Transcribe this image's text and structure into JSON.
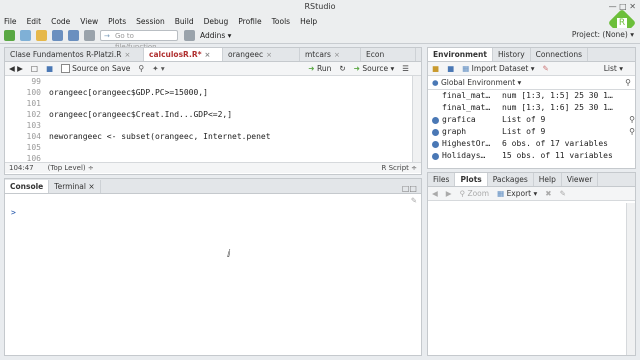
{
  "window": {
    "title": "RStudio"
  },
  "menu": [
    "File",
    "Edit",
    "Code",
    "View",
    "Plots",
    "Session",
    "Build",
    "Debug",
    "Profile",
    "Tools",
    "Help"
  ],
  "toolbar": {
    "goto_placeholder": "Go to file/function",
    "addins_label": "Addins ▾",
    "project_label": "Project: (None) ▾"
  },
  "source": {
    "tabs": [
      {
        "label": "Clase Fundamentos R-Platzi.R",
        "active": false
      },
      {
        "label": "calculosR.R*",
        "active": true
      },
      {
        "label": "orangeec",
        "active": false
      },
      {
        "label": "mtcars",
        "active": false
      },
      {
        "label": "Econ",
        "active": false
      }
    ],
    "source_on_save_label": "Source on Save",
    "run_label": "Run",
    "source_label": "Source",
    "lines": [
      {
        "n": "99",
        "code": ""
      },
      {
        "n": "100",
        "code": "orangeec[orangeec$GDP.PC>=15000,]"
      },
      {
        "n": "101",
        "code": ""
      },
      {
        "n": "102",
        "code": "orangeec[orangeec$Creat.Ind...GDP<=2,]"
      },
      {
        "n": "103",
        "code": ""
      },
      {
        "n": "104",
        "code": "neworangeec <- subset(orangeec, Internet.penet"
      },
      {
        "n": "105",
        "code": ""
      },
      {
        "n": "106",
        "code": ""
      }
    ],
    "cursor_pos": "104:47",
    "scope": "(Top Level) ÷",
    "file_type": "R Script ÷"
  },
  "console": {
    "tabs": [
      "Console",
      "Terminal ×"
    ],
    "prompt": ">"
  },
  "environment": {
    "tabs": [
      "Environment",
      "History",
      "Connections"
    ],
    "import_label": "Import Dataset ▾",
    "list_label": "List ▾",
    "scope_label": "Global Environment ▾",
    "rows": [
      {
        "name": "final_mat…",
        "val": "num [1:3, 1:5] 25 30 1…",
        "dot": false
      },
      {
        "name": "final_mat…",
        "val": "num [1:3, 1:6] 25 30 1…",
        "dot": false
      },
      {
        "name": "grafica",
        "val": "List of 9",
        "dot": true
      },
      {
        "name": "graph",
        "val": "List of 9",
        "dot": true
      },
      {
        "name": "HighestOr…",
        "val": "6 obs. of 17 variables",
        "dot": true
      },
      {
        "name": "Holidays…",
        "val": "15 obs. of 11 variables",
        "dot": true
      }
    ]
  },
  "files": {
    "tabs": [
      "Files",
      "Plots",
      "Packages",
      "Help",
      "Viewer"
    ],
    "zoom_label": "Zoom",
    "export_label": "Export ▾"
  },
  "colors": {
    "accent": "#6cbf3a",
    "link_blue": "#4a78b5"
  }
}
